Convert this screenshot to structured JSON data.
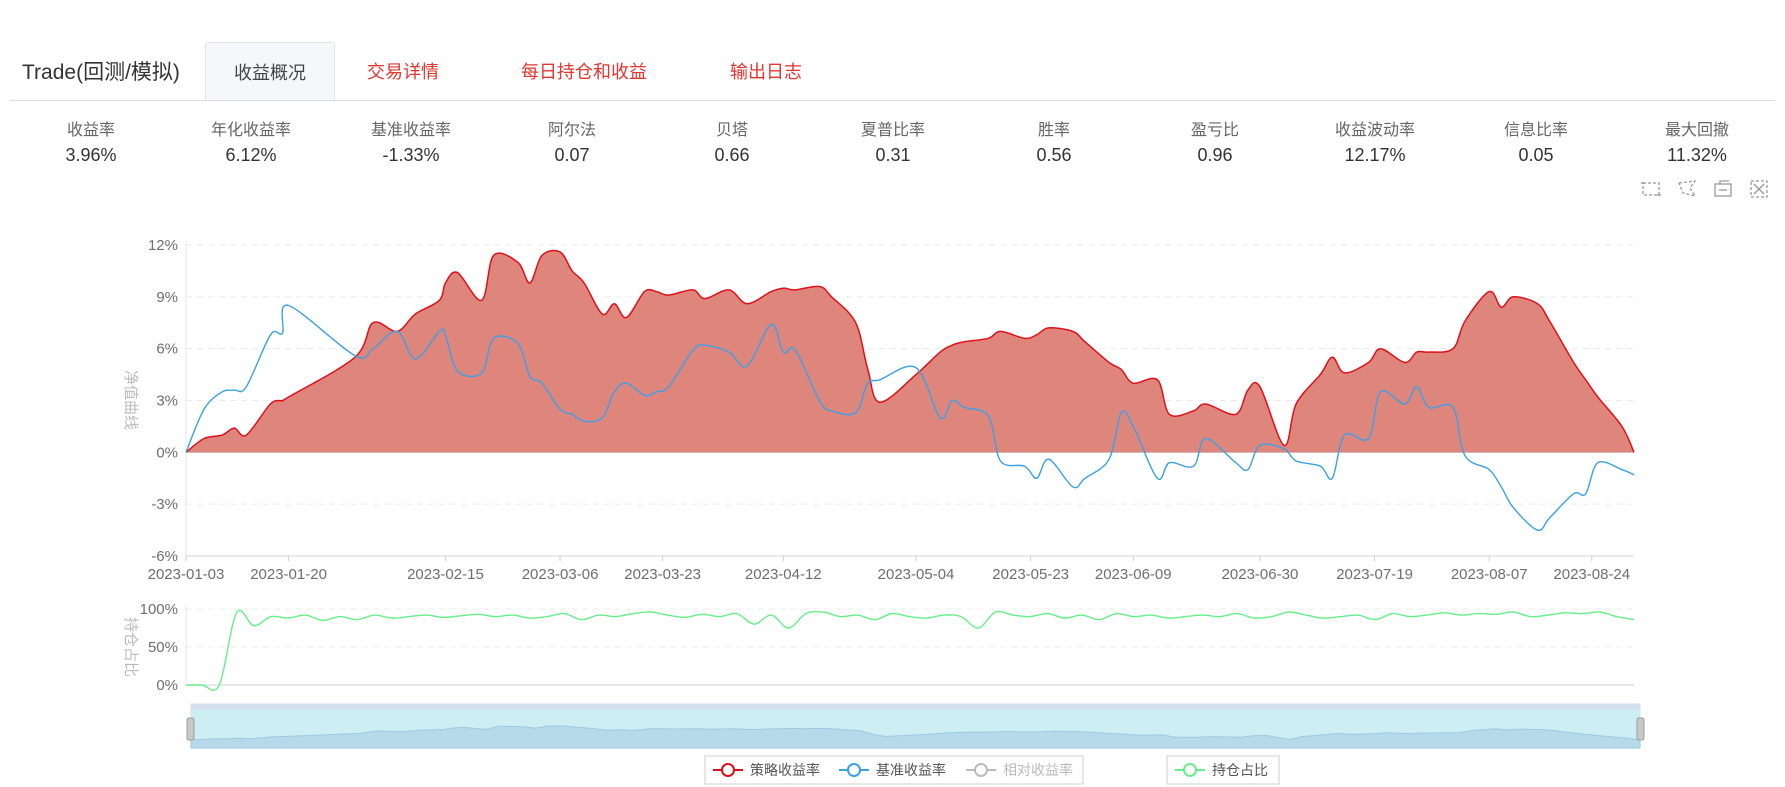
{
  "header": {
    "title": "Trade(回测/模拟)",
    "tabs": [
      {
        "label": "收益概况",
        "active": true
      },
      {
        "label": "交易详情",
        "active": false
      },
      {
        "label": "每日持仓和收益",
        "active": false
      },
      {
        "label": "输出日志",
        "active": false
      }
    ]
  },
  "metrics": [
    {
      "label": "收益率",
      "value": "3.96%"
    },
    {
      "label": "年化收益率",
      "value": "6.12%"
    },
    {
      "label": "基准收益率",
      "value": "-1.33%"
    },
    {
      "label": "阿尔法",
      "value": "0.07"
    },
    {
      "label": "贝塔",
      "value": "0.66"
    },
    {
      "label": "夏普比率",
      "value": "0.31"
    },
    {
      "label": "胜率",
      "value": "0.56"
    },
    {
      "label": "盈亏比",
      "value": "0.96"
    },
    {
      "label": "收益波动率",
      "value": "12.17%"
    },
    {
      "label": "信息比率",
      "value": "0.05"
    },
    {
      "label": "最大回撤",
      "value": "11.32%"
    }
  ],
  "toolbox": [
    "zoom-select-icon",
    "lasso-icon",
    "zoom-back-icon",
    "zoom-reset-icon"
  ],
  "colors": {
    "strategy": "#e0101a",
    "strategy_area": "#d9756a",
    "benchmark": "#3aa0e8",
    "relative": "#bbbbbb",
    "position": "#66ee88",
    "accent": "#e3342f"
  },
  "chart_data": [
    {
      "type": "area",
      "ylabel": "净值曲线",
      "ylim": [
        -6,
        12
      ],
      "y_ticks": [
        "12%",
        "9%",
        "6%",
        "3%",
        "0%",
        "-3%",
        "-6%"
      ],
      "x_ticks": [
        "2023-01-03",
        "2023-01-20",
        "2023-02-15",
        "2023-03-06",
        "2023-03-23",
        "2023-04-12",
        "2023-05-04",
        "2023-05-23",
        "2023-06-09",
        "2023-06-30",
        "2023-07-19",
        "2023-08-07",
        "2023-08-24"
      ],
      "x": [
        "2023-01-03",
        "2023-01-06",
        "2023-01-09",
        "2023-01-11",
        "2023-01-13",
        "2023-01-17",
        "2023-01-19",
        "2023-01-20",
        "2023-01-31",
        "2023-02-03",
        "2023-02-07",
        "2023-02-10",
        "2023-02-14",
        "2023-02-15",
        "2023-02-17",
        "2023-02-21",
        "2023-02-23",
        "2023-02-27",
        "2023-03-01",
        "2023-03-03",
        "2023-03-06",
        "2023-03-08",
        "2023-03-10",
        "2023-03-13",
        "2023-03-15",
        "2023-03-17",
        "2023-03-20",
        "2023-03-22",
        "2023-03-24",
        "2023-03-28",
        "2023-03-30",
        "2023-04-03",
        "2023-04-06",
        "2023-04-10",
        "2023-04-12",
        "2023-04-14",
        "2023-04-18",
        "2023-04-20",
        "2023-04-24",
        "2023-04-26",
        "2023-04-28",
        "2023-05-04",
        "2023-05-08",
        "2023-05-10",
        "2023-05-12",
        "2023-05-16",
        "2023-05-18",
        "2023-05-22",
        "2023-05-24",
        "2023-05-26",
        "2023-05-30",
        "2023-06-01",
        "2023-06-05",
        "2023-06-07",
        "2023-06-09",
        "2023-06-13",
        "2023-06-15",
        "2023-06-19",
        "2023-06-21",
        "2023-06-26",
        "2023-06-28",
        "2023-06-30",
        "2023-07-04",
        "2023-07-06",
        "2023-07-10",
        "2023-07-12",
        "2023-07-14",
        "2023-07-18",
        "2023-07-20",
        "2023-07-24",
        "2023-07-26",
        "2023-07-28",
        "2023-08-01",
        "2023-08-03",
        "2023-08-07",
        "2023-08-09",
        "2023-08-11",
        "2023-08-15",
        "2023-08-17",
        "2023-08-21",
        "2023-08-23",
        "2023-08-25",
        "2023-08-29",
        "2023-08-31"
      ],
      "series": [
        {
          "name": "策略收益率",
          "values": [
            0.0,
            0.8,
            1.0,
            1.4,
            1.0,
            2.8,
            3.0,
            3.2,
            5.5,
            7.5,
            7.0,
            8.0,
            8.8,
            9.8,
            10.4,
            8.8,
            11.4,
            11.0,
            9.8,
            11.4,
            11.6,
            10.5,
            9.8,
            8.0,
            8.6,
            7.8,
            9.3,
            9.3,
            9.1,
            9.4,
            8.9,
            9.4,
            8.6,
            9.3,
            9.5,
            9.4,
            9.6,
            9.0,
            7.5,
            4.8,
            2.9,
            4.5,
            5.8,
            6.2,
            6.4,
            6.6,
            7.0,
            6.6,
            6.8,
            7.2,
            7.0,
            6.4,
            5.2,
            4.8,
            4.0,
            4.2,
            2.2,
            2.4,
            2.8,
            2.2,
            3.6,
            3.8,
            0.4,
            2.8,
            4.5,
            5.5,
            4.6,
            5.2,
            6.0,
            5.2,
            5.8,
            5.8,
            6.0,
            7.6,
            9.3,
            8.4,
            9.0,
            8.6,
            7.6,
            5.2,
            4.2,
            3.2,
            1.5,
            0.0
          ]
        },
        {
          "name": "基准收益率",
          "values": [
            0.0,
            2.5,
            3.5,
            3.6,
            3.8,
            6.8,
            6.9,
            8.5,
            5.6,
            6.0,
            7.0,
            5.4,
            7.0,
            6.8,
            4.7,
            4.6,
            6.6,
            6.3,
            4.4,
            4.0,
            2.5,
            2.2,
            1.8,
            2.0,
            3.5,
            4.0,
            3.3,
            3.5,
            3.8,
            5.9,
            6.2,
            5.8,
            5.0,
            7.4,
            5.8,
            5.9,
            3.0,
            2.4,
            2.3,
            4.0,
            4.2,
            4.9,
            2.0,
            3.0,
            2.6,
            2.1,
            -0.5,
            -0.8,
            -1.5,
            -0.4,
            -2.0,
            -1.5,
            -0.4,
            2.3,
            1.5,
            -1.5,
            -0.6,
            -0.8,
            0.8,
            -0.6,
            -1.0,
            0.4,
            0.2,
            -0.5,
            -0.8,
            -1.5,
            1.0,
            0.8,
            3.5,
            2.8,
            3.8,
            2.6,
            2.6,
            -0.2,
            -1.0,
            -2.0,
            -3.2,
            -4.5,
            -3.8,
            -2.4,
            -2.4,
            -0.6,
            -1.0,
            -1.3
          ]
        }
      ],
      "legend": [
        "策略收益率",
        "基准收益率",
        "相对收益率"
      ],
      "legend_position": "bottom"
    },
    {
      "type": "line",
      "ylabel": "持仓占比",
      "ylim": [
        0,
        100
      ],
      "y_ticks": [
        "100%",
        "50%",
        "0%"
      ],
      "series": [
        {
          "name": "持仓占比",
          "values": [
            0,
            0,
            95,
            78,
            90,
            88,
            92,
            85,
            90,
            86,
            92,
            88,
            90,
            92,
            89,
            91,
            93,
            90,
            92,
            88,
            90,
            94,
            86,
            92,
            90,
            94,
            96,
            92,
            89,
            93,
            90,
            94,
            80,
            92,
            75,
            94,
            96,
            90,
            92,
            86,
            94,
            90,
            88,
            92,
            90,
            75,
            96,
            92,
            90,
            94,
            88,
            92,
            86,
            94,
            90,
            92,
            88,
            90,
            92,
            90,
            94,
            88,
            90,
            96,
            92,
            88,
            90,
            92,
            86,
            94,
            90,
            92,
            95,
            92,
            94,
            93,
            96,
            90,
            92,
            95,
            94,
            96,
            90,
            86
          ]
        }
      ],
      "legend": [
        "持仓占比"
      ]
    }
  ]
}
